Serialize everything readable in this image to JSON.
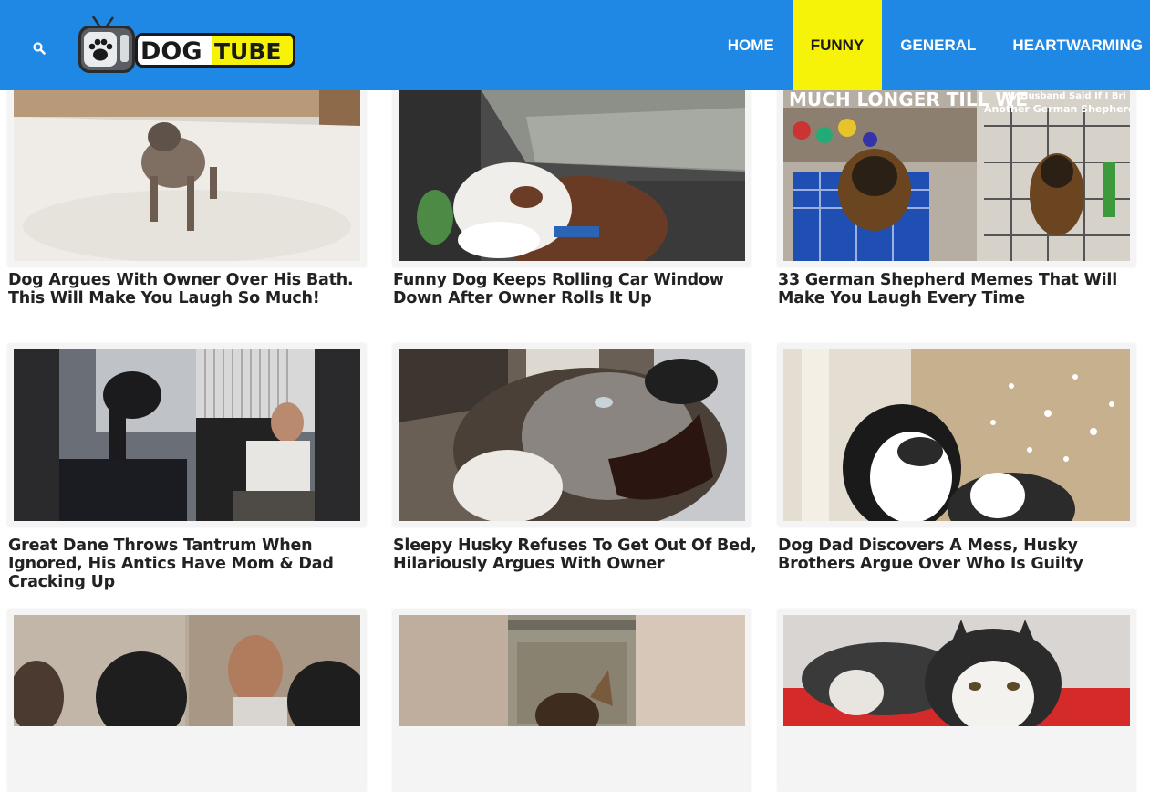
{
  "header": {
    "logo": {
      "part1": "DOG",
      "part2": "TUBE"
    },
    "search_icon": "search-icon",
    "nav": [
      "HOME",
      "FUNNY",
      "GENERAL",
      "HEARTWARMING"
    ],
    "active_nav": "FUNNY"
  },
  "colors": {
    "header_bg": "#1f88e5",
    "nav_active_bg": "#f6f208",
    "logo_yellow": "#f6f208"
  },
  "thumbnail_texts": {
    "meme_left": "MUCH LONGER TILL WE",
    "meme_right_1": "My Husband Said If I Bri",
    "meme_right_2": "Another German Shepherd"
  },
  "articles": [
    {
      "title": "Dog Argues With Owner Over His Bath. This Will Make You Laugh So Much!"
    },
    {
      "title": "Funny Dog Keeps Rolling Car Window Down After Owner Rolls It Up"
    },
    {
      "title": "33 German Shepherd Memes That Will Make You Laugh Every Time"
    },
    {
      "title": "Great Dane Throws Tantrum When Ignored, His Antics Have Mom & Dad Cracking Up"
    },
    {
      "title": "Sleepy Husky Refuses To Get Out Of Bed, Hilariously Argues With Owner"
    },
    {
      "title": "Dog Dad Discovers A Mess, Husky Brothers Argue Over Who Is Guilty"
    },
    {
      "title": ""
    },
    {
      "title": ""
    },
    {
      "title": ""
    }
  ]
}
